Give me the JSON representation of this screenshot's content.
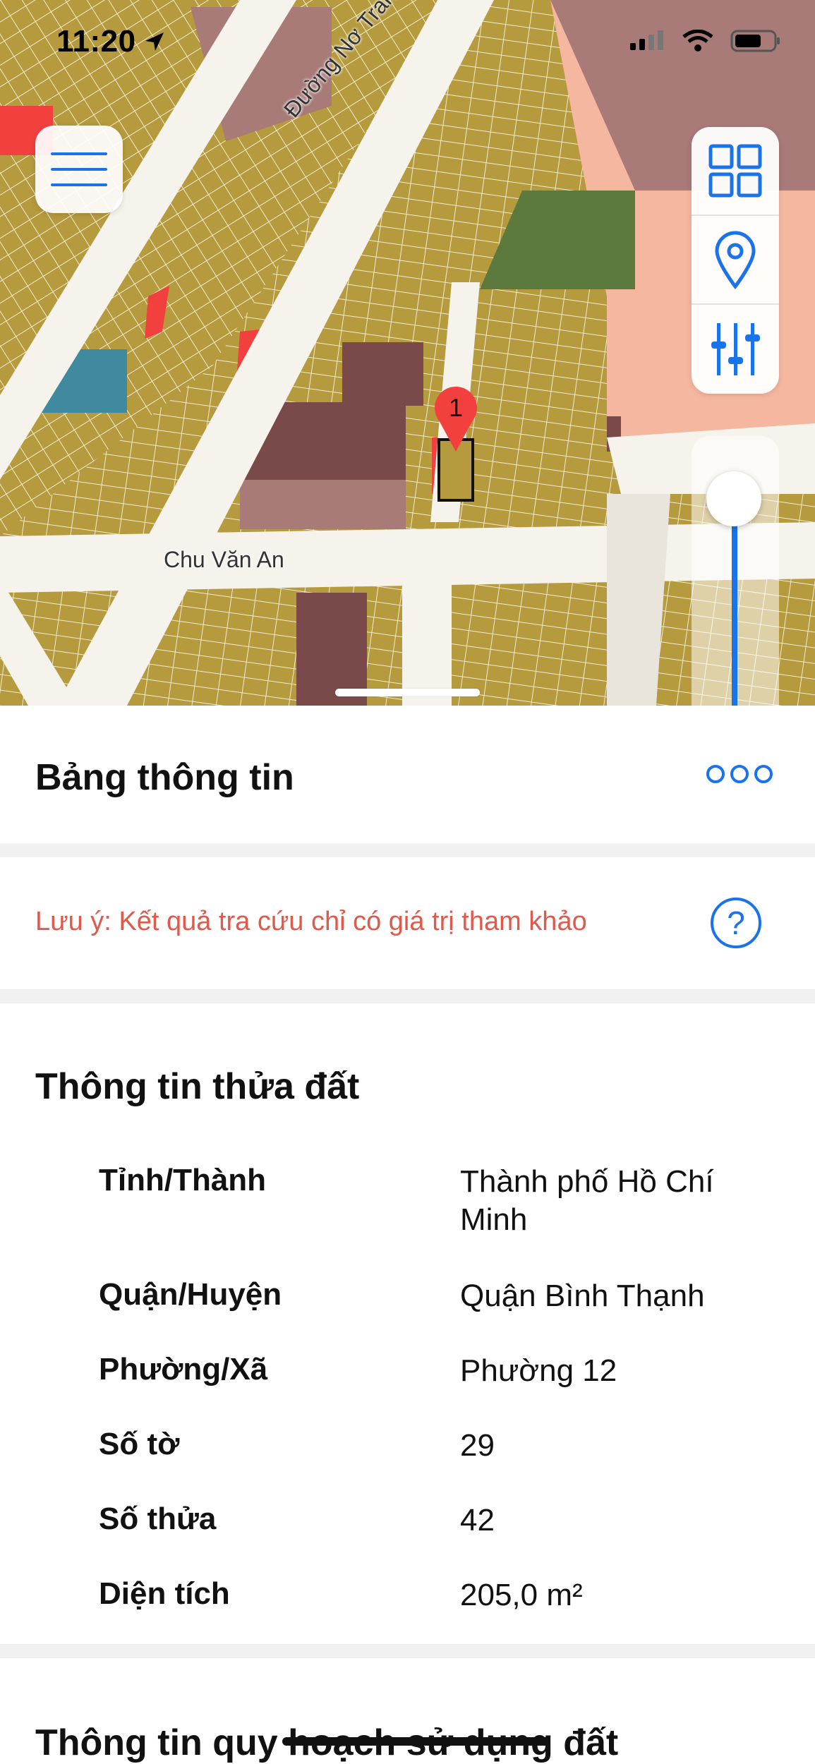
{
  "status_bar": {
    "time": "11:20"
  },
  "map": {
    "street_labels": [
      "Đường Nơ Trang Long",
      "Chu Văn An"
    ],
    "marker_label": "1",
    "colors": {
      "residential": "#b59a3e",
      "commercial": "#7a4a4a",
      "public": "#a87a78",
      "green": "#5d7a3e",
      "water": "#3f8a9e",
      "road": "#f6f3ec",
      "highlight": "#f2403f",
      "peach": "#f6b7a0"
    }
  },
  "toolbar": {
    "menu_icon": "hamburger-menu-icon",
    "layers_icon": "grid-layers-icon",
    "location_icon": "location-pin-icon",
    "filter_icon": "sliders-icon"
  },
  "panel": {
    "title": "Bảng thông tin",
    "note": "Lưu ý: Kết quả tra cứu chỉ có giá trị tham khảo",
    "help_label": "?",
    "parcel_section_title": "Thông tin thửa đất",
    "parcel_rows": [
      {
        "label": "Tỉnh/Thành",
        "value": "Thành phố Hồ Chí Minh"
      },
      {
        "label": "Quận/Huyện",
        "value": "Quận Bình Thạnh"
      },
      {
        "label": "Phường/Xã",
        "value": "Phường 12"
      },
      {
        "label": "Số tờ",
        "value": "29"
      },
      {
        "label": "Số thửa",
        "value": "42"
      },
      {
        "label": "Diện tích",
        "value": "205,0 m²"
      }
    ],
    "planning_section_title": "Thông tin quy hoạch sử dụng đất"
  },
  "accent_color": "#1a73e8",
  "note_color": "#e05a4b"
}
